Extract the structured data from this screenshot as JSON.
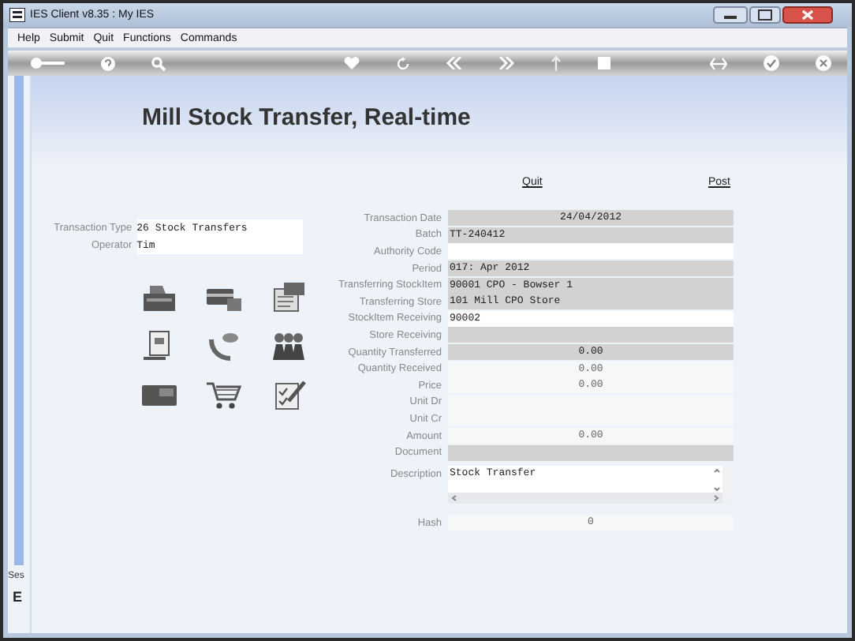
{
  "window": {
    "title": "IES Client v8.35 : My IES"
  },
  "menu": [
    "Help",
    "Submit",
    "Quit",
    "Functions",
    "Commands"
  ],
  "heading": "Mill Stock Transfer, Real-time",
  "left_fields": [
    {
      "label": "Transaction Type",
      "value": "26 Stock Transfers"
    },
    {
      "label": "Operator",
      "value": "Tim"
    }
  ],
  "links": [
    "Quit",
    "Post"
  ],
  "fields": [
    {
      "label": "Transaction Date",
      "value": "24/04/2012",
      "kind": "locked",
      "numeric": true
    },
    {
      "label": "Batch",
      "value": "TT-240412",
      "kind": "locked",
      "numeric": false
    },
    {
      "label": "Authority Code",
      "kind": "entry"
    },
    {
      "label": "Period",
      "value": "017: Apr 2012",
      "kind": "locked",
      "numeric": false
    },
    {
      "label": "Transferring StockItem",
      "value": "90001 CPO - Bowser 1",
      "kind": "locked",
      "numeric": false
    },
    {
      "label": "Transferring Store",
      "value": "101 Mill CPO Store",
      "kind": "locked",
      "numeric": false
    },
    {
      "label": "StockItem Receiving",
      "value": "90002",
      "kind": "entry",
      "numeric": false
    },
    {
      "label": "Store Receiving",
      "kind": "locked"
    },
    {
      "label": "Quantity Transferred",
      "value": "0.00",
      "kind": "locked",
      "numeric": true
    },
    {
      "label": "Quantity Received",
      "value": "0.00",
      "kind": "readout",
      "numeric": true
    },
    {
      "label": "Price",
      "value": "0.00",
      "kind": "readout",
      "numeric": true
    },
    {
      "label": "Unit Dr",
      "kind": "readout"
    },
    {
      "label": "Unit Cr",
      "kind": "readout"
    },
    {
      "label": "Amount",
      "value": "0.00",
      "kind": "readout",
      "numeric": true
    },
    {
      "label": "Document",
      "kind": "locked"
    }
  ],
  "description": {
    "label": "Description",
    "value": "Stock Transfer"
  },
  "hash": {
    "label": "Hash",
    "value": "0"
  },
  "sidebar": [
    "Ses",
    "E"
  ]
}
